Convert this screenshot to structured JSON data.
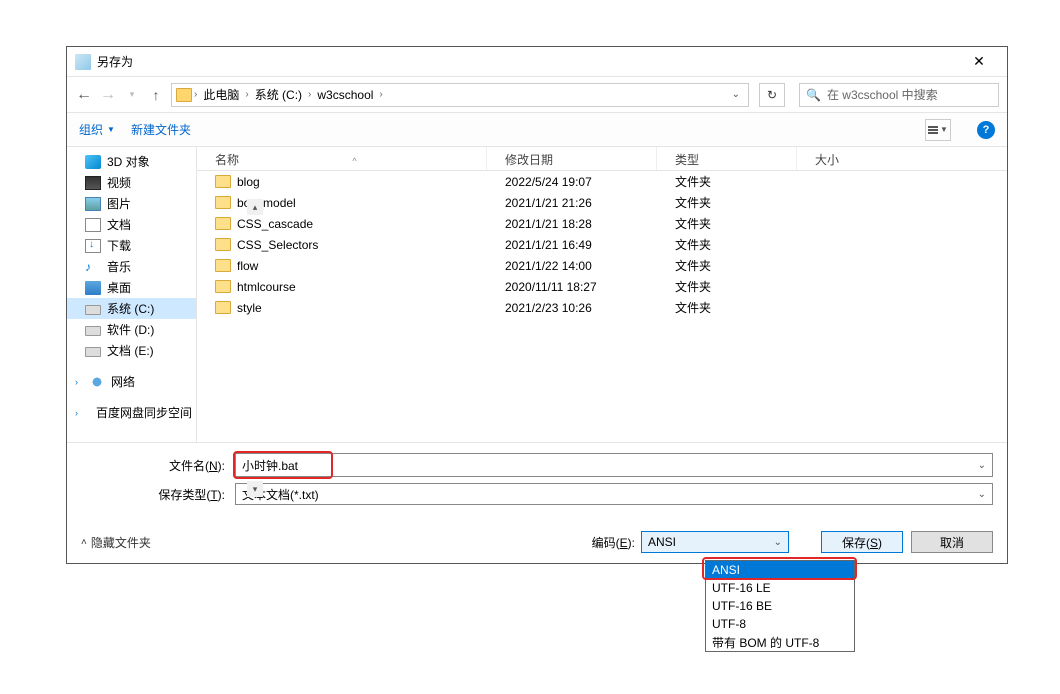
{
  "title": "另存为",
  "breadcrumb": {
    "root": "此电脑",
    "p1": "系统 (C:)",
    "p2": "w3cschool"
  },
  "search": {
    "placeholder": "在 w3cschool 中搜索"
  },
  "toolbar": {
    "org": "组织",
    "newfolder": "新建文件夹"
  },
  "headers": {
    "name": "名称",
    "date": "修改日期",
    "type": "类型",
    "size": "大小"
  },
  "sidebar": {
    "items": [
      "3D 对象",
      "视频",
      "图片",
      "文档",
      "下载",
      "音乐",
      "桌面",
      "系统 (C:)",
      "软件 (D:)",
      "文档 (E:)"
    ],
    "network": "网络",
    "baidu": "百度网盘同步空间"
  },
  "files": [
    {
      "name": "blog",
      "date": "2022/5/24 19:07",
      "type": "文件夹"
    },
    {
      "name": "box_model",
      "date": "2021/1/21 21:26",
      "type": "文件夹"
    },
    {
      "name": "CSS_cascade",
      "date": "2021/1/21 18:28",
      "type": "文件夹"
    },
    {
      "name": "CSS_Selectors",
      "date": "2021/1/21 16:49",
      "type": "文件夹"
    },
    {
      "name": "flow",
      "date": "2021/1/22 14:00",
      "type": "文件夹"
    },
    {
      "name": "htmlcourse",
      "date": "2020/11/11 18:27",
      "type": "文件夹"
    },
    {
      "name": "style",
      "date": "2021/2/23 10:26",
      "type": "文件夹"
    }
  ],
  "form": {
    "filename_label": "文件名(N):",
    "filename_value": "小时钟.bat",
    "savetype_label": "保存类型(T):",
    "savetype_value": "文本文档(*.txt)"
  },
  "footer": {
    "hide": "隐藏文件夹",
    "enc_label": "编码(E):",
    "enc_value": "ANSI",
    "save": "保存(S)",
    "cancel": "取消"
  },
  "encoding_options": [
    "ANSI",
    "UTF-16 LE",
    "UTF-16 BE",
    "UTF-8",
    "带有 BOM 的 UTF-8"
  ]
}
